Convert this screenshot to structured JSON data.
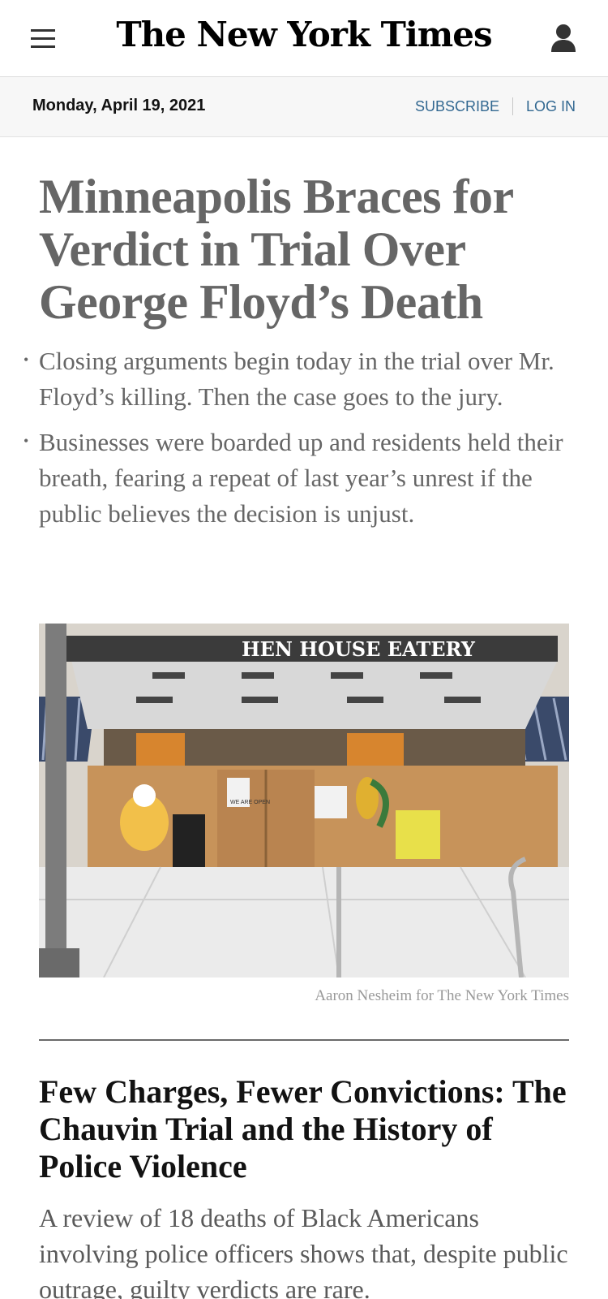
{
  "header": {
    "masthead": "The New York Times",
    "menu_icon": "hamburger-menu-icon",
    "account_icon": "user-account-icon"
  },
  "datebar": {
    "date": "Monday, April 19, 2021",
    "subscribe": "SUBSCRIBE",
    "login": "LOG IN"
  },
  "lead_story": {
    "headline": "Minneapolis Braces for Verdict in Trial Over George Floyd’s Death",
    "bullets": [
      "Closing arguments begin today in the trial over Mr. Floyd’s killing. Then the case goes to the jury.",
      "Businesses were boarded up and residents held their breath, fearing a repeat of last year’s unrest if the public believes the decision is unjust."
    ],
    "photo": {
      "sign_text": "HEN HOUSE EATERY",
      "door_sign": "WE ARE OPEN",
      "credit": "Aaron Nesheim for The New York Times"
    }
  },
  "second_story": {
    "headline": "Few Charges, Fewer Convictions: The Chauvin Trial and the History of Police Violence",
    "summary": "A review of 18 deaths of Black Americans involving police officers shows that, despite public outrage, guilty verdicts are rare."
  },
  "colors": {
    "link": "#326891",
    "lead_text": "#666666",
    "datebar_bg": "#f7f7f7"
  }
}
